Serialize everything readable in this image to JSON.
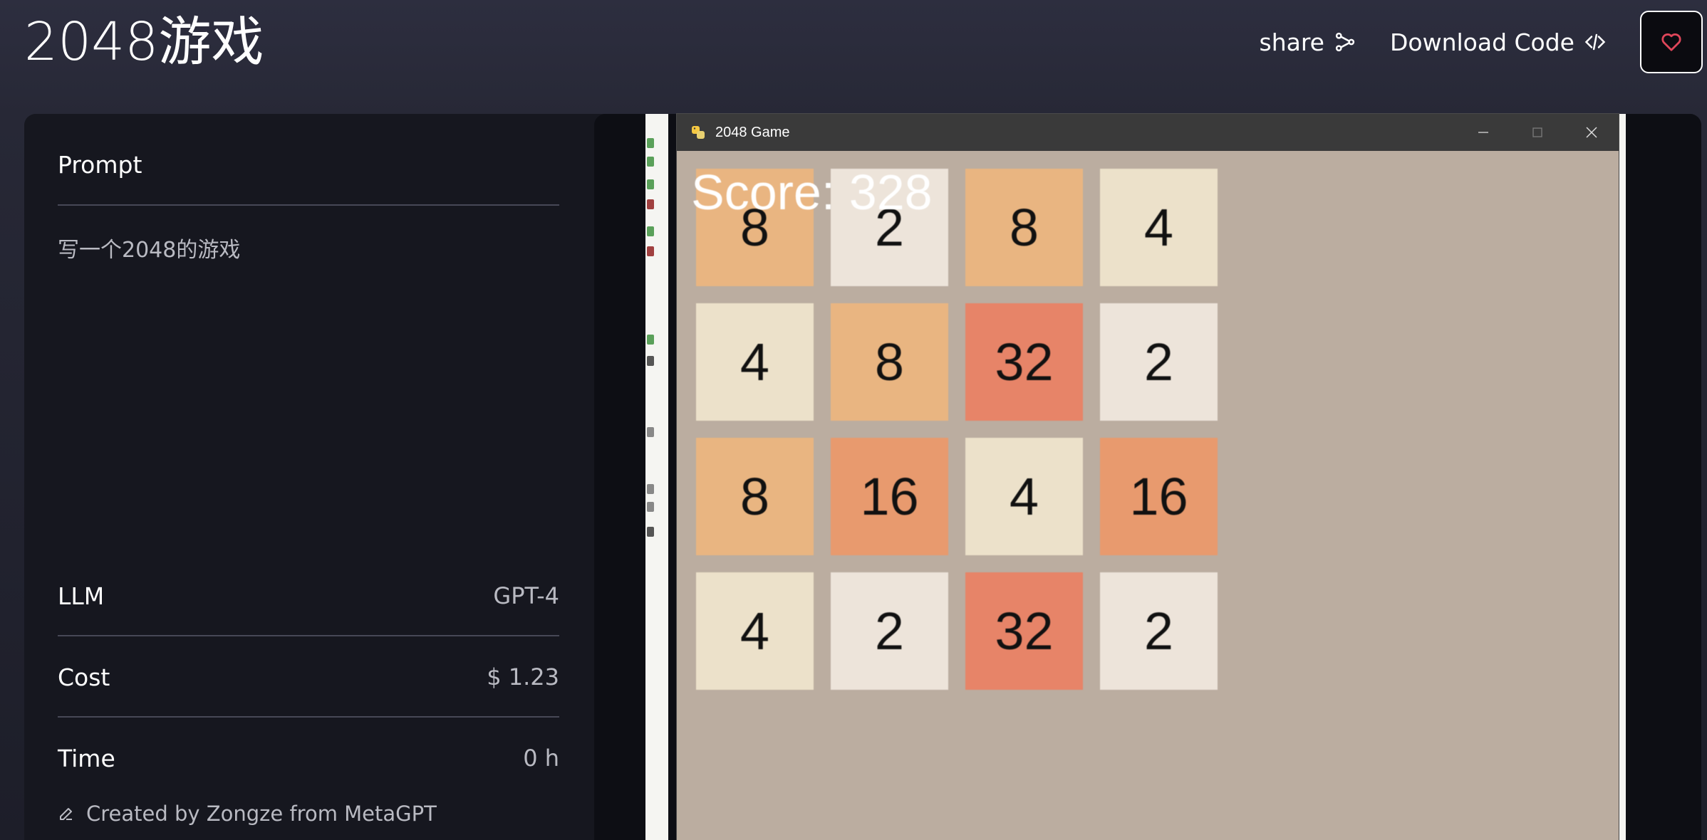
{
  "header": {
    "title": "2048游戏",
    "share_label": "share",
    "download_label": "Download Code"
  },
  "icons": {
    "share": "share-icon",
    "code": "code-icon",
    "heart": "heart-icon",
    "edit": "edit-icon",
    "close": "close-icon",
    "minimize": "minimize-icon",
    "maximize": "maximize-icon"
  },
  "colors": {
    "accent_heart": "#e0465a",
    "background": "#272836",
    "card": "#16171f",
    "game_bg": "#bbada0"
  },
  "info": {
    "prompt_label": "Prompt",
    "prompt_text": "写一个2048的游戏",
    "llm_label": "LLM",
    "llm_value": "GPT-4",
    "cost_label": "Cost",
    "cost_value": "$ 1.23",
    "time_label": "Time",
    "time_value": "0 h",
    "created_by": "Created by Zongze from MetaGPT"
  },
  "game": {
    "window_title": "2048 Game",
    "score": "Score: 328",
    "tiles": [
      {
        "value": "8",
        "color": "#e9b581"
      },
      {
        "value": "2",
        "color": "#ede4da"
      },
      {
        "value": "8",
        "color": "#e9b581"
      },
      {
        "value": "4",
        "color": "#ece1ca"
      },
      {
        "value": "4",
        "color": "#ece1ca"
      },
      {
        "value": "8",
        "color": "#e9b581"
      },
      {
        "value": "32",
        "color": "#e78468"
      },
      {
        "value": "2",
        "color": "#ede4da"
      },
      {
        "value": "8",
        "color": "#e9b581"
      },
      {
        "value": "16",
        "color": "#e89a6e"
      },
      {
        "value": "4",
        "color": "#ece1ca"
      },
      {
        "value": "16",
        "color": "#e89a6e"
      },
      {
        "value": "4",
        "color": "#ece1ca"
      },
      {
        "value": "2",
        "color": "#ede4da"
      },
      {
        "value": "32",
        "color": "#e78468"
      },
      {
        "value": "2",
        "color": "#ede4da"
      }
    ]
  }
}
